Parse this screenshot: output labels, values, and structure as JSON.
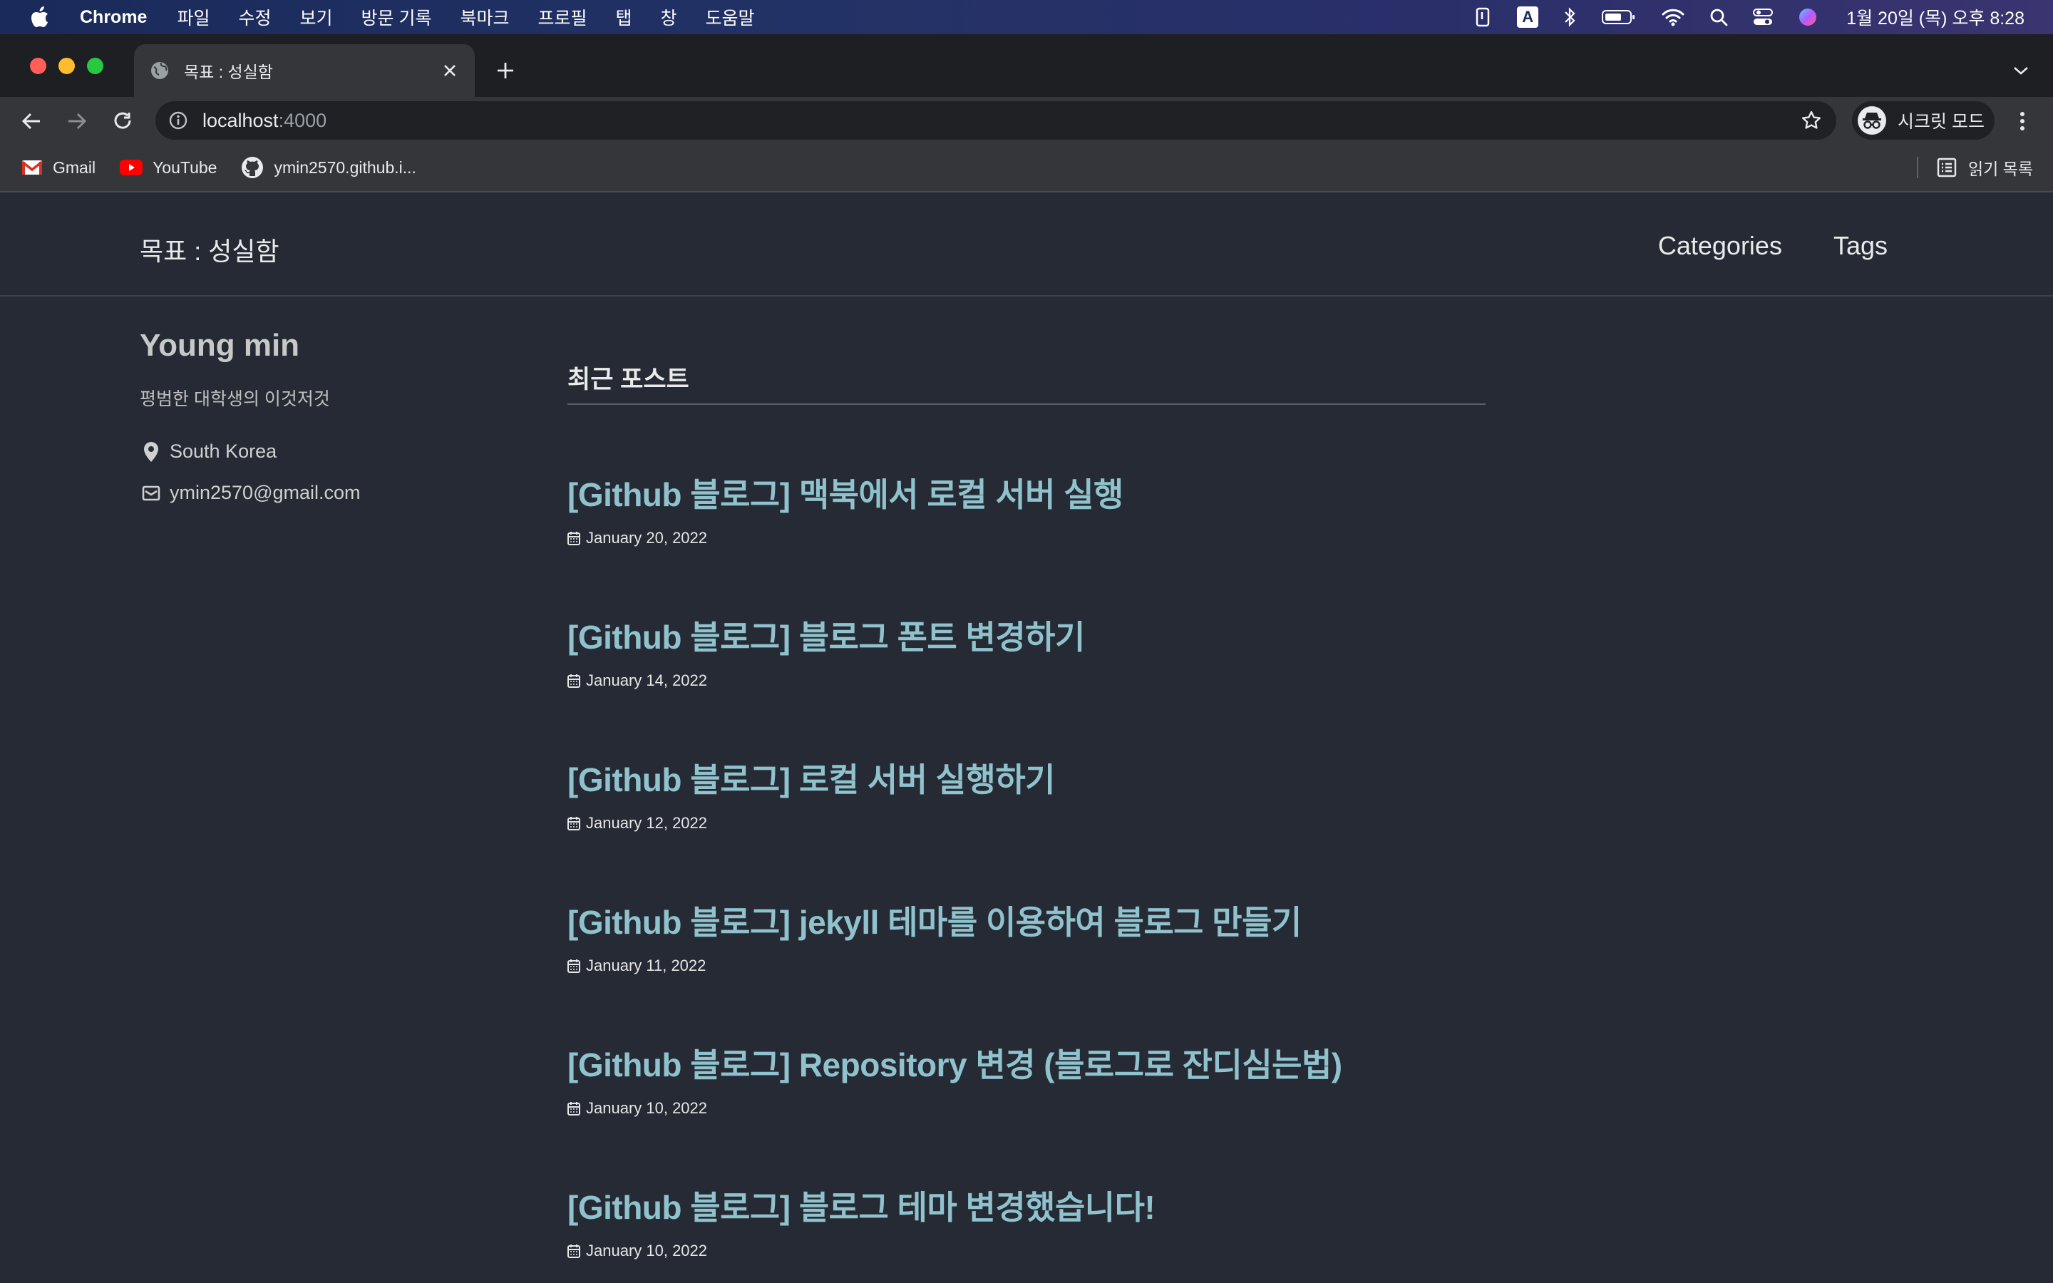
{
  "menubar": {
    "app_name": "Chrome",
    "items": [
      "파일",
      "수정",
      "보기",
      "방문 기록",
      "북마크",
      "프로필",
      "탭",
      "창",
      "도움말"
    ],
    "input_source": "A",
    "clock": "1월 20일 (목) 오후 8:28"
  },
  "browser": {
    "tab_title": "목표 : 성실함",
    "url_host": "localhost",
    "url_port": ":4000",
    "incognito_label": "시크릿 모드",
    "bookmarks": [
      {
        "label": "Gmail",
        "icon": "gmail-icon"
      },
      {
        "label": "YouTube",
        "icon": "youtube-icon"
      },
      {
        "label": "ymin2570.github.i...",
        "icon": "github-icon"
      }
    ],
    "reading_list": "읽기 목록"
  },
  "site": {
    "title": "목표 : 성실함",
    "nav": [
      "Categories",
      "Tags"
    ]
  },
  "author": {
    "name": "Young min",
    "bio": "평범한 대학생의 이것저것",
    "location": "South Korea",
    "email": "ymin2570@gmail.com"
  },
  "main": {
    "section_title": "최근 포스트",
    "posts": [
      {
        "title": "[Github 블로그] 맥북에서 로컬 서버 실행",
        "date": "January 20, 2022"
      },
      {
        "title": "[Github 블로그] 블로그 폰트 변경하기",
        "date": "January 14, 2022"
      },
      {
        "title": "[Github 블로그] 로컬 서버 실행하기",
        "date": "January 12, 2022"
      },
      {
        "title": "[Github 블로그] jekyll 테마를 이용하여 블로그 만들기",
        "date": "January 11, 2022"
      },
      {
        "title": "[Github 블로그] Repository 변경 (블로그로 잔디심는법)",
        "date": "January 10, 2022"
      },
      {
        "title": "[Github 블로그] 블로그 테마 변경했습니다!",
        "date": "January 10, 2022"
      }
    ]
  },
  "colors": {
    "page_bg": "#252a34",
    "link": "#8fc2cc",
    "chrome_toolbar": "#35363a"
  }
}
